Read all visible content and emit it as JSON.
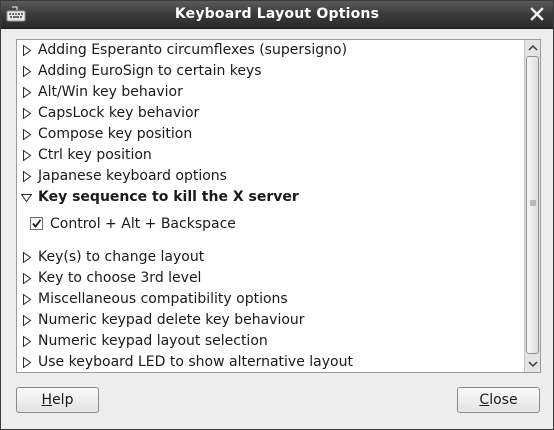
{
  "window": {
    "title": "Keyboard Layout Options"
  },
  "options": {
    "items": [
      {
        "label": "Adding Esperanto circumflexes (supersigno)",
        "expanded": false
      },
      {
        "label": "Adding EuroSign to certain keys",
        "expanded": false
      },
      {
        "label": "Alt/Win key behavior",
        "expanded": false
      },
      {
        "label": "CapsLock key behavior",
        "expanded": false
      },
      {
        "label": "Compose key position",
        "expanded": false
      },
      {
        "label": "Ctrl key position",
        "expanded": false
      },
      {
        "label": "Japanese keyboard options",
        "expanded": false
      },
      {
        "label": "Key sequence to kill the X server",
        "expanded": true
      },
      {
        "label": "Key(s) to change layout",
        "expanded": false
      },
      {
        "label": "Key to choose 3rd level",
        "expanded": false
      },
      {
        "label": "Miscellaneous compatibility options",
        "expanded": false
      },
      {
        "label": "Numeric keypad delete key behaviour",
        "expanded": false
      },
      {
        "label": "Numeric keypad layout selection",
        "expanded": false
      },
      {
        "label": "Use keyboard LED to show alternative layout",
        "expanded": false
      }
    ],
    "kill_server_choice": {
      "label": "Control + Alt + Backspace",
      "checked": true
    }
  },
  "buttons": {
    "help": {
      "mnemonic": "H",
      "rest": "elp"
    },
    "close": {
      "mnemonic": "C",
      "rest": "lose"
    }
  },
  "icons": {
    "app": "keyboard-icon",
    "close": "close-icon",
    "collapsed": "triangle-right-icon",
    "expanded": "triangle-down-icon",
    "check": "checkmark-icon"
  },
  "colors": {
    "titlebar": "#3c3c3c",
    "window_bg": "#ededed",
    "list_bg": "#ffffff"
  }
}
